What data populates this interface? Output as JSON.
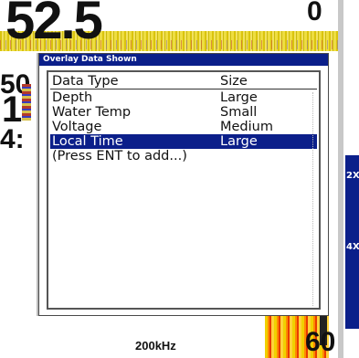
{
  "display": {
    "depth_value": "52.5",
    "range_top": "0",
    "range_bottom": "60",
    "frequency": "200kHz",
    "partial_left_1": "50",
    "partial_left_2": "1",
    "partial_left_3": "4:",
    "zoom_top": "2X",
    "zoom_bottom": "4X"
  },
  "dialog": {
    "title": "Overlay Data Shown",
    "columns": {
      "type": "Data Type",
      "size": "Size"
    },
    "rows": [
      {
        "type": "Depth",
        "size": "Large",
        "selected": false
      },
      {
        "type": "Water Temp",
        "size": "Small",
        "selected": false
      },
      {
        "type": "Voltage",
        "size": "Medium",
        "selected": false
      },
      {
        "type": "Local Time",
        "size": "Large",
        "selected": true
      },
      {
        "type": "(Press ENT to add...)",
        "size": "",
        "selected": false
      }
    ]
  },
  "colors": {
    "title_bar": "#0b1f8a",
    "selection": "#0b1f8a",
    "zoom_bar": "#0b1f8a"
  }
}
